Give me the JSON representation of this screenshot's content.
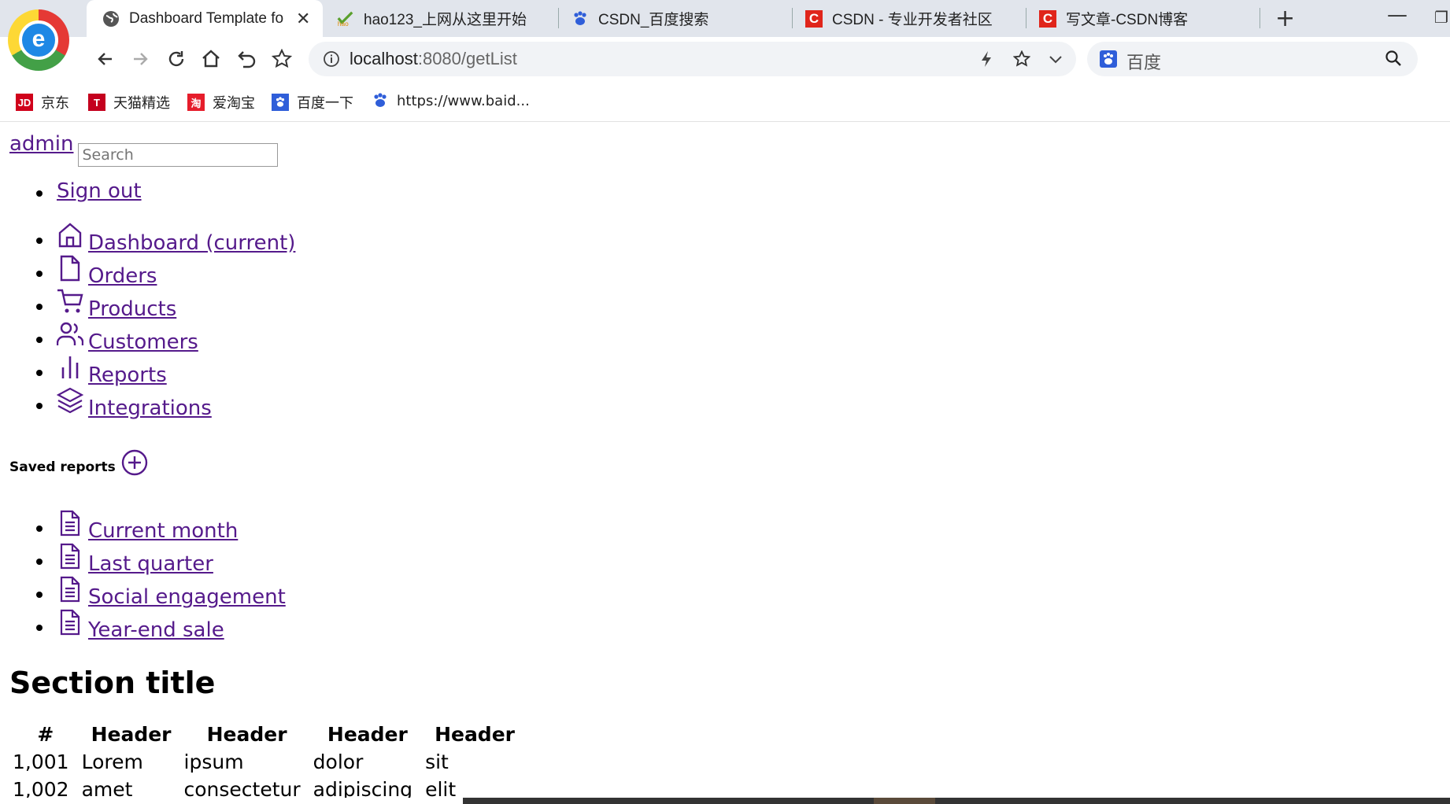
{
  "browser": {
    "tabs": [
      {
        "title": "Dashboard Template fo",
        "active": true,
        "icon": "globe-icon"
      },
      {
        "title": "hao123_上网从这里开始",
        "active": false,
        "icon": "hao123-icon"
      },
      {
        "title": "CSDN_百度搜索",
        "active": false,
        "icon": "baidu-paw-icon"
      },
      {
        "title": "CSDN - 专业开发者社区",
        "active": false,
        "icon": "csdn-icon"
      },
      {
        "title": "写文章-CSDN博客",
        "active": false,
        "icon": "csdn-icon"
      }
    ],
    "url_host": "localhost",
    "url_rest": ":8080/getList",
    "search_placeholder": "百度",
    "bookmarks": [
      {
        "label": "京东",
        "icon_text": "JD",
        "color": "#d0021b"
      },
      {
        "label": "天猫精选",
        "icon_text": "T",
        "color": "#c4001e"
      },
      {
        "label": "爱淘宝",
        "icon_text": "淘",
        "color": "#e61d2b"
      },
      {
        "label": "百度一下",
        "icon_text": "",
        "color": "#2f5ed9"
      },
      {
        "label": "https://www.baid...",
        "icon_text": "",
        "color": "#2f5ed9"
      }
    ]
  },
  "page": {
    "brand": "admin",
    "search_placeholder": "Search",
    "signout": "Sign out",
    "nav": [
      {
        "label": "Dashboard (current)",
        "icon": "home-icon"
      },
      {
        "label": "Orders",
        "icon": "file-icon"
      },
      {
        "label": "Products",
        "icon": "shopping-cart-icon"
      },
      {
        "label": "Customers",
        "icon": "users-icon"
      },
      {
        "label": "Reports",
        "icon": "bar-chart-icon"
      },
      {
        "label": "Integrations",
        "icon": "layers-icon"
      }
    ],
    "saved_reports_heading": "Saved reports",
    "saved_reports": [
      {
        "label": "Current month"
      },
      {
        "label": "Last quarter"
      },
      {
        "label": "Social engagement"
      },
      {
        "label": "Year-end sale"
      }
    ],
    "section_title": "Section title",
    "table": {
      "headers": [
        "#",
        "Header",
        "Header",
        "Header",
        "Header"
      ],
      "rows": [
        [
          "1,001",
          "Lorem",
          "ipsum",
          "dolor",
          "sit"
        ],
        [
          "1,002",
          "amet",
          "consectetur",
          "adipiscing",
          "elit"
        ]
      ]
    },
    "link_color": "#551a8b"
  }
}
